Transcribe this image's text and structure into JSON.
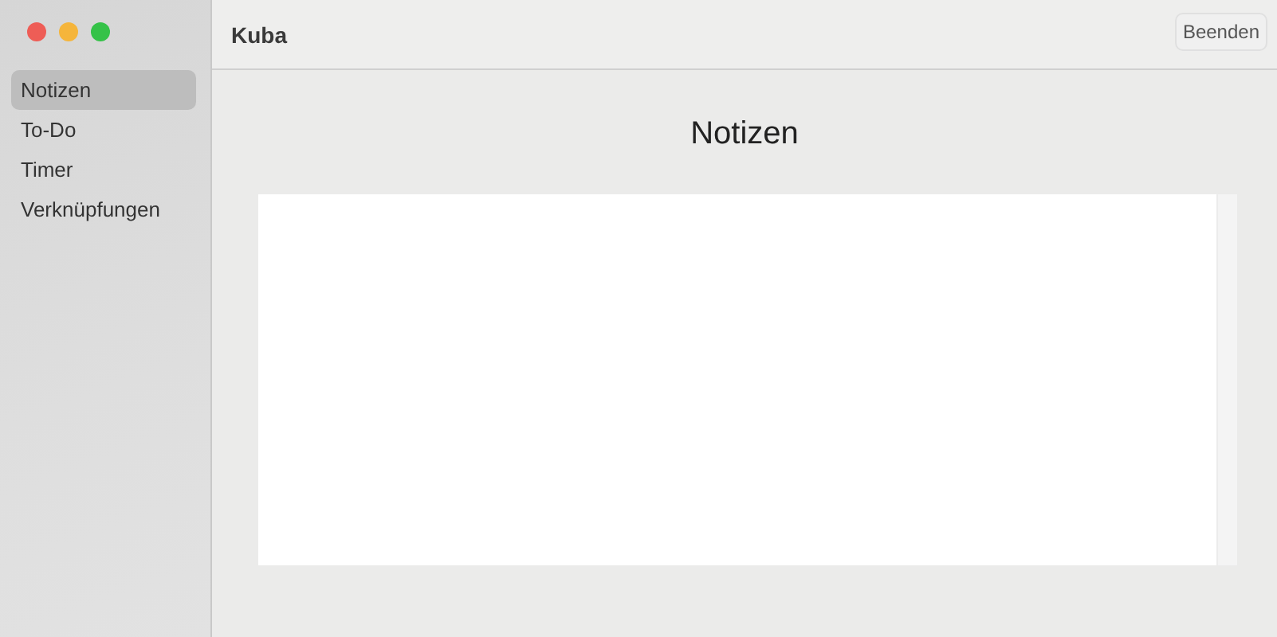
{
  "window": {
    "title": "Kuba"
  },
  "sidebar": {
    "items": [
      {
        "label": "Notizen",
        "selected": true
      },
      {
        "label": "To-Do",
        "selected": false
      },
      {
        "label": "Timer",
        "selected": false
      },
      {
        "label": "Verknüpfungen",
        "selected": false
      }
    ]
  },
  "toolbar": {
    "buttons": [
      "Beenden"
    ]
  },
  "content": {
    "heading": "Notizen"
  }
}
